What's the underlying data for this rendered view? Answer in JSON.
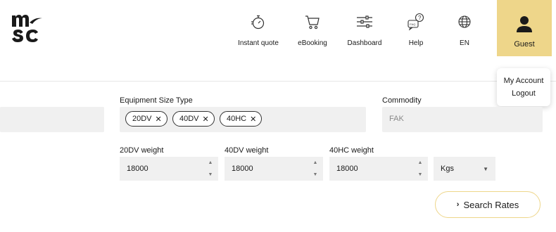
{
  "header": {
    "logo_text": "msc",
    "nav": [
      {
        "label": "Instant quote",
        "icon": "stopwatch-icon"
      },
      {
        "label": "eBooking",
        "icon": "cart-icon"
      },
      {
        "label": "Dashboard",
        "icon": "sliders-icon"
      },
      {
        "label": "Help",
        "icon": "help-chat-icon"
      },
      {
        "label": "EN",
        "icon": "globe-icon"
      }
    ],
    "guest": {
      "label": "Guest",
      "icon": "user-icon",
      "bg": "#eed68a"
    }
  },
  "user_menu": {
    "items": [
      "My Account",
      "Logout"
    ]
  },
  "form": {
    "equipment": {
      "label": "Equipment Size Type",
      "chips": [
        "20DV",
        "40DV",
        "40HC"
      ]
    },
    "commodity": {
      "label": "Commodity",
      "value": "FAK"
    },
    "weights": [
      {
        "label": "20DV weight",
        "value": "18000"
      },
      {
        "label": "40DV weight",
        "value": "18000"
      },
      {
        "label": "40HC weight",
        "value": "18000"
      }
    ],
    "unit": {
      "value": "Kgs"
    },
    "search_button": {
      "label": "Search Rates"
    }
  },
  "colors": {
    "accent": "#eed68a",
    "field_bg": "#f0f0f0"
  }
}
